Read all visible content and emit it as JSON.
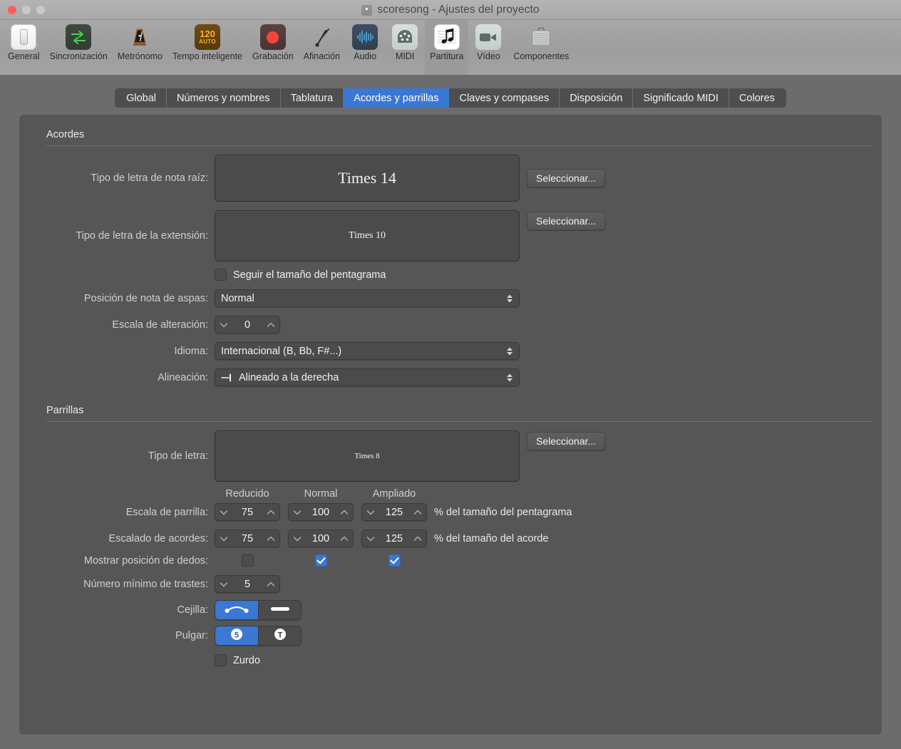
{
  "window": {
    "title": "scoresong - Ajustes del proyecto",
    "doc_icon": "project-document-icon",
    "traffic_lights": [
      "close-button",
      "minimize-button",
      "zoom-button"
    ]
  },
  "toolbar": {
    "items": [
      {
        "label": "General",
        "icon": "switch-icon"
      },
      {
        "label": "Sincronización",
        "icon": "sync-arrows-icon"
      },
      {
        "label": "Metrónomo",
        "icon": "metronome-icon"
      },
      {
        "label": "Tempo inteligente",
        "icon": "tempo-120-auto-icon",
        "badge_value": "120",
        "badge_sub": "AUTO"
      },
      {
        "label": "Grabación",
        "icon": "record-dot-icon"
      },
      {
        "label": "Afinación",
        "icon": "tuning-fork-icon"
      },
      {
        "label": "Audio",
        "icon": "audio-waveform-icon"
      },
      {
        "label": "MIDI",
        "icon": "midi-connector-icon"
      },
      {
        "label": "Partitura",
        "icon": "music-note-score-icon",
        "selected": true
      },
      {
        "label": "Vídeo",
        "icon": "video-camera-icon"
      },
      {
        "label": "Componentes",
        "icon": "briefcase-icon"
      }
    ]
  },
  "tabs": [
    {
      "label": "Global",
      "active": false
    },
    {
      "label": "Números y nombres",
      "active": false
    },
    {
      "label": "Tablatura",
      "active": false
    },
    {
      "label": "Acordes y parrillas",
      "active": true
    },
    {
      "label": "Claves y compases",
      "active": false
    },
    {
      "label": "Disposición",
      "active": false
    },
    {
      "label": "Significado MIDI",
      "active": false
    },
    {
      "label": "Colores",
      "active": false
    }
  ],
  "accent_color": "#3b77d4",
  "sections": {
    "chords": {
      "title": "Acordes",
      "root_font": {
        "label": "Tipo de letra de nota raíz:",
        "value": "Times 14",
        "button": "Seleccionar..."
      },
      "extension_font": {
        "label": "Tipo de letra de la extensión:",
        "value": "Times 10",
        "button": "Seleccionar..."
      },
      "follow_staff_size": {
        "label": "Seguir el tamaño del pentagrama",
        "checked": false
      },
      "cross_note_position": {
        "label": "Posición de nota de aspas:",
        "value": "Normal"
      },
      "accidental_scale": {
        "label": "Escala de alteración:",
        "value": "0"
      },
      "language": {
        "label": "Idioma:",
        "value": "Internacional (B, Bb, F#...)"
      },
      "alignment": {
        "label": "Alineación:",
        "value": "Alineado a la derecha",
        "icon": "align-right-icon"
      }
    },
    "grids": {
      "title": "Parrillas",
      "font": {
        "label": "Tipo de letra:",
        "value": "Times 8",
        "button": "Seleccionar..."
      },
      "column_headers": [
        "Reducido",
        "Normal",
        "Ampliado"
      ],
      "grid_scale": {
        "label": "Escala de parrilla:",
        "values": [
          "75",
          "100",
          "125"
        ],
        "unit": "% del tamaño del pentagrama"
      },
      "chord_scale": {
        "label": "Escalado de acordes:",
        "values": [
          "75",
          "100",
          "125"
        ],
        "unit": "% del tamaño del acorde"
      },
      "show_fingering": {
        "label": "Mostrar posición de dedos:",
        "checked": [
          false,
          true,
          true
        ]
      },
      "min_frets": {
        "label": "Número mínimo de trastes:",
        "value": "5"
      },
      "capo": {
        "label": "Cejilla:",
        "options": [
          "capo-arc-icon",
          "capo-bar-icon"
        ],
        "selected_index": 0
      },
      "thumb": {
        "label": "Pulgar:",
        "options": [
          "thumb-5-icon",
          "thumb-t-icon"
        ],
        "selected_index": 0
      },
      "left_handed": {
        "label": "Zurdo",
        "checked": false
      }
    }
  }
}
